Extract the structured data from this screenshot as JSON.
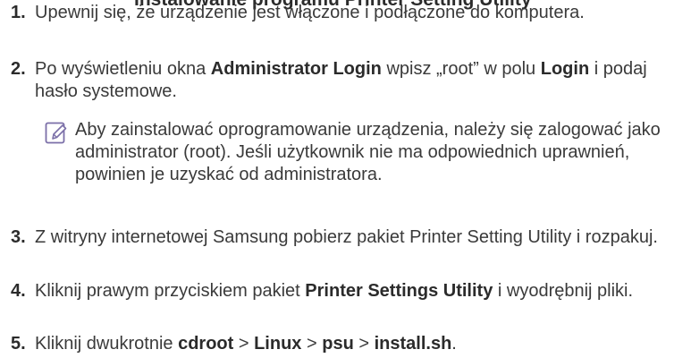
{
  "heading_fragment": "Instalowanie programu Printer Setting Utility",
  "steps": [
    {
      "number": "1.",
      "parts": [
        {
          "text": "Upewnij się, że urządzenie jest włączone i podłączone do komputera.",
          "bold": false
        }
      ]
    },
    {
      "number": "2.",
      "parts": [
        {
          "text": "Po wyświetleniu okna ",
          "bold": false
        },
        {
          "text": "Administrator Login",
          "bold": true
        },
        {
          "text": " wpisz „root” w polu ",
          "bold": false
        },
        {
          "text": "Login",
          "bold": true
        },
        {
          "text": " i podaj hasło systemowe.",
          "bold": false
        }
      ]
    },
    {
      "number": "3.",
      "parts": [
        {
          "text": "Z witryny internetowej Samsung pobierz pakiet Printer Setting Utility i rozpakuj.",
          "bold": false
        }
      ]
    },
    {
      "number": "4.",
      "parts": [
        {
          "text": "Kliknij prawym przyciskiem pakiet ",
          "bold": false
        },
        {
          "text": "Printer Settings Utility",
          "bold": true
        },
        {
          "text": " i wyodrębnij pliki.",
          "bold": false
        }
      ]
    },
    {
      "number": "5.",
      "parts": [
        {
          "text": "Kliknij dwukrotnie ",
          "bold": false
        },
        {
          "text": "cdroot",
          "bold": true
        },
        {
          "text": " > ",
          "bold": false
        },
        {
          "text": "Linux",
          "bold": true
        },
        {
          "text": " > ",
          "bold": false
        },
        {
          "text": "psu",
          "bold": true
        },
        {
          "text": " > ",
          "bold": false
        },
        {
          "text": "install.sh",
          "bold": true
        },
        {
          "text": ".",
          "bold": false
        }
      ]
    }
  ],
  "note": {
    "icon": "note-pencil-icon",
    "text": "Aby zainstalować oprogramowanie urządzenia, należy się zalogować jako administrator (root). Jeśli użytkownik nie ma odpowiednich uprawnień, powinien je uzyskać od administratora.",
    "icon_color": "#7b6fa8"
  }
}
